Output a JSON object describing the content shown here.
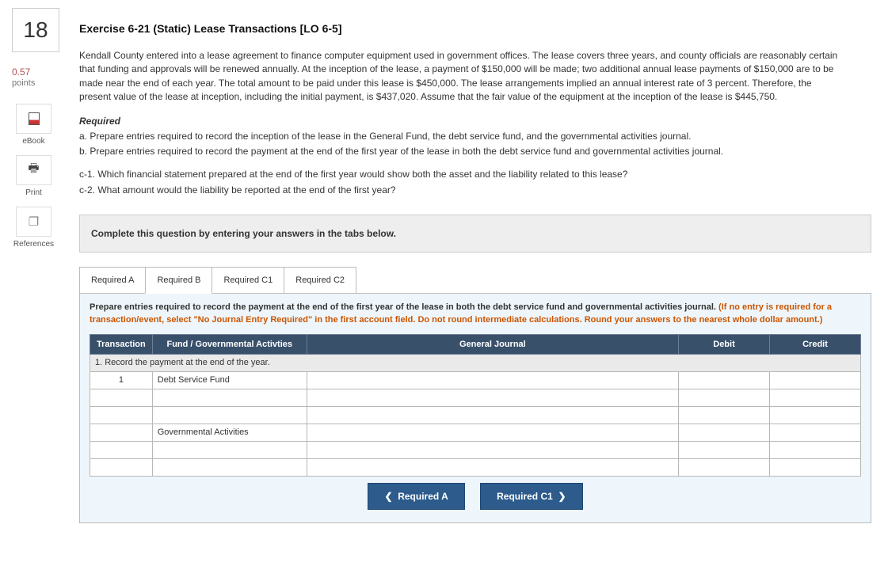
{
  "question_number": "18",
  "points_value": "0.57",
  "points_label": "points",
  "tools": {
    "ebook": "eBook",
    "print": "Print",
    "references": "References"
  },
  "title": "Exercise 6-21 (Static) Lease Transactions [LO 6-5]",
  "problem_text": "Kendall County entered into a lease agreement to finance computer equipment used in government offices. The lease covers three years, and county officials are reasonably certain that funding and approvals will be renewed annually. At the inception of the lease, a payment of $150,000 will be made; two additional annual lease payments of $150,000 are to be made near the end of each year. The total amount to be paid under this lease is $450,000. The lease arrangements implied an annual interest rate of 3 percent. Therefore, the present value of the lease at inception, including the initial payment, is $437,020. Assume that the fair value of the equipment at the inception of the lease is $445,750.",
  "required_header": "Required",
  "requirements": {
    "a": "a. Prepare entries required to record the inception of the lease in the General Fund, the debt service fund, and the governmental activities journal.",
    "b": "b. Prepare entries required to record the payment at the end of the first year of the lease in both the debt service fund and governmental activities journal.",
    "c1": "c-1. Which financial statement prepared at the end of the first year would show both the asset and the liability related to this lease?",
    "c2": "c-2. What amount would the liability be reported at the end of the first year?"
  },
  "instruction_bar": "Complete this question by entering your answers in the tabs below.",
  "tabs": {
    "a": "Required A",
    "b": "Required B",
    "c1": "Required C1",
    "c2": "Required C2"
  },
  "panel": {
    "main": "Prepare entries required to record the payment at the end of the first year of the lease in both the debt service fund and governmental activities journal.",
    "hint": "(If no entry is required for a transaction/event, select \"No Journal Entry Required\" in the first account field. Do not round intermediate calculations. Round your answers to the nearest whole dollar amount.)"
  },
  "table": {
    "headers": {
      "transaction": "Transaction",
      "fund": "Fund / Governmental Activties",
      "gj": "General Journal",
      "debit": "Debit",
      "credit": "Credit"
    },
    "section1_label": "1. Record the payment at the end of the year.",
    "row1_trans": "1",
    "row1_fund": "Debt Service Fund",
    "row4_fund": "Governmental Activities"
  },
  "nav": {
    "prev": "Required A",
    "next": "Required C1"
  }
}
